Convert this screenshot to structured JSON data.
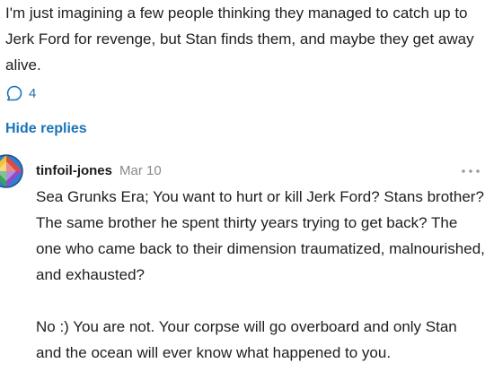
{
  "parent_comment": {
    "text": "I'm just imagining a few people thinking they managed to catch up to Jerk Ford for revenge, but Stan finds them, and maybe they get away alive.",
    "reply_count": "4",
    "reply_icon": "speech-bubble-icon"
  },
  "replies_toggle": {
    "label": "Hide replies"
  },
  "reply": {
    "username": "tinfoil-jones",
    "date": "Mar 10",
    "more_icon": "more-horizontal-icon",
    "paragraphs": [
      "Sea Grunks Era; You want to hurt or kill Jerk Ford? Stans brother? The same brother he spent thirty years trying to get back? The one who came back to their dimension traumatized, malnourished, and exhausted?",
      "No :) You are not. Your corpse will go overboard and only Stan and the ocean will ever know what happened to you."
    ]
  },
  "colors": {
    "link_blue": "#1a73b8",
    "text": "#1e1e1e",
    "muted": "#8a8a8a"
  }
}
